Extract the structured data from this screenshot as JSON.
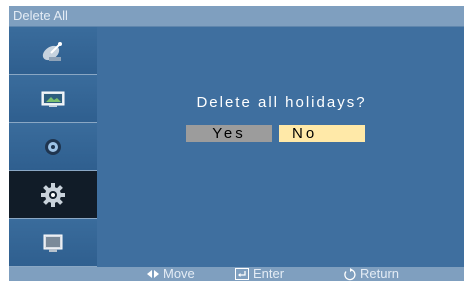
{
  "window": {
    "title": "Delete All"
  },
  "sidebar": {
    "items": [
      {
        "icon": "satellite-dish-icon",
        "active": false
      },
      {
        "icon": "picture-icon",
        "active": false
      },
      {
        "icon": "sound-icon",
        "active": false
      },
      {
        "icon": "settings-gear-icon",
        "active": true
      },
      {
        "icon": "input-source-icon",
        "active": false
      }
    ]
  },
  "dialog": {
    "question": "Delete all holidays?",
    "yes_label": "Yes",
    "no_label": "No",
    "selected": "No"
  },
  "footer": {
    "move_label": "Move",
    "enter_label": "Enter",
    "return_label": "Return"
  },
  "colors": {
    "background": "#3f6f9f",
    "titlebar": "#7f9fbf",
    "selected_button": "#ffe9a8",
    "unselected_button": "#9c9c9c"
  }
}
